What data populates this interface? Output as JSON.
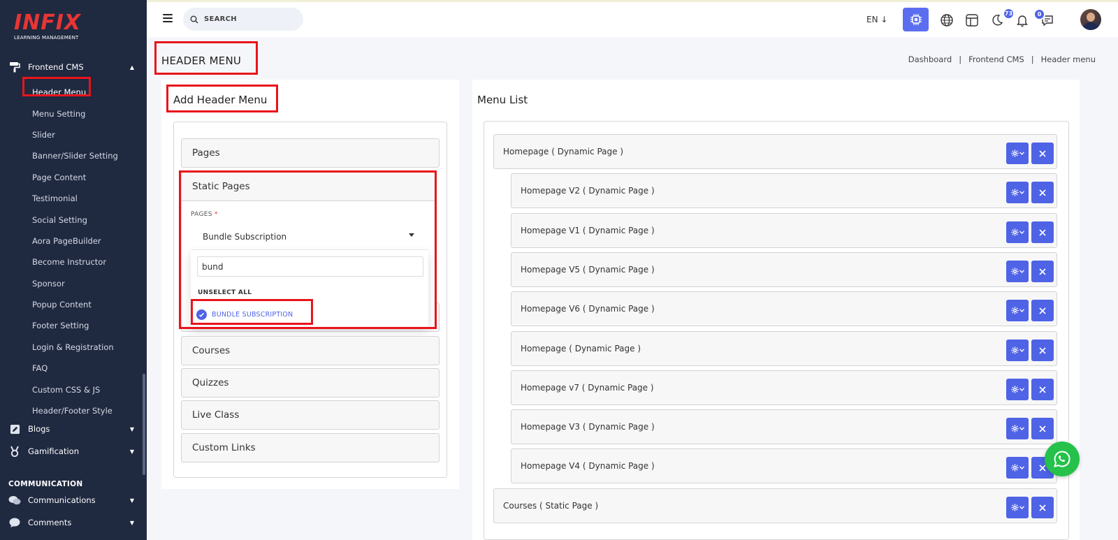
{
  "brand": {
    "name": "INFIX",
    "tagline": "LEARNING MANAGEMENT"
  },
  "sidebar": {
    "group": {
      "label": "Frontend CMS",
      "icon": "paint-roller-icon"
    },
    "items": [
      {
        "label": "Header Menu",
        "active": true
      },
      {
        "label": "Menu Setting"
      },
      {
        "label": "Slider"
      },
      {
        "label": "Banner/Slider Setting"
      },
      {
        "label": "Page Content"
      },
      {
        "label": "Testimonial"
      },
      {
        "label": "Social Setting"
      },
      {
        "label": "Aora PageBuilder"
      },
      {
        "label": "Become Instructor"
      },
      {
        "label": "Sponsor"
      },
      {
        "label": "Popup Content"
      },
      {
        "label": "Footer Setting"
      },
      {
        "label": "Login & Registration"
      },
      {
        "label": "FAQ"
      },
      {
        "label": "Custom CSS & JS"
      },
      {
        "label": "Header/Footer Style"
      }
    ],
    "blogs": {
      "label": "Blogs",
      "icon": "edit-icon"
    },
    "gamification": {
      "label": "Gamification",
      "icon": "medal-icon"
    },
    "section": "COMMUNICATION",
    "communications": {
      "label": "Communications",
      "icon": "chat-icon"
    },
    "comments": {
      "label": "Comments",
      "icon": "comment-icon"
    }
  },
  "topbar": {
    "search_placeholder": "SEARCH",
    "lang": "EN",
    "notifications_count": "73",
    "messages_count": "0"
  },
  "page": {
    "title": "HEADER MENU",
    "breadcrumb": [
      "Dashboard",
      "Frontend CMS",
      "Header menu"
    ]
  },
  "add_panel": {
    "title": "Add Header Menu",
    "accordions": [
      "Pages",
      "Courses",
      "Quizzes",
      "Live Class",
      "Custom Links"
    ],
    "static": {
      "title": "Static Pages",
      "field_label": "PAGES",
      "required_mark": "*",
      "selected": "Bundle Subscription",
      "search_value": "bund",
      "unselect_all": "UNSELECT ALL",
      "option": "BUNDLE SUBSCRIPTION"
    }
  },
  "menu_list": {
    "title": "Menu List",
    "items": [
      {
        "label": "Homepage ( Dynamic Page )",
        "level": 0
      },
      {
        "label": "Homepage V2 ( Dynamic Page )",
        "level": 1
      },
      {
        "label": "Homepage V1 ( Dynamic Page )",
        "level": 1
      },
      {
        "label": "Homepage V5 ( Dynamic Page )",
        "level": 1
      },
      {
        "label": "Homepage V6 ( Dynamic Page )",
        "level": 1
      },
      {
        "label": "Homepage ( Dynamic Page )",
        "level": 1
      },
      {
        "label": "Homepage v7 ( Dynamic Page )",
        "level": 1
      },
      {
        "label": "Homepage V3 ( Dynamic Page )",
        "level": 1
      },
      {
        "label": "Homepage V4 ( Dynamic Page )",
        "level": 1
      },
      {
        "label": "Courses ( Static Page )",
        "level": 0
      }
    ]
  },
  "colors": {
    "accent": "#4f63e6",
    "highlight": "#e8141b",
    "sidebar": "#1f2940",
    "whatsapp": "#25c14a"
  }
}
